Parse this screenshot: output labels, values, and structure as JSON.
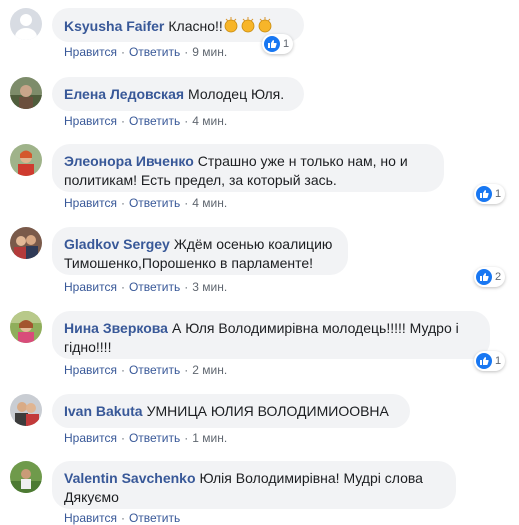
{
  "action_labels": {
    "like": "Нравится",
    "reply": "Ответить",
    "separator": "·"
  },
  "comments": [
    {
      "author": "Ksyusha Faifer",
      "text": "Класно!!",
      "emoji": [
        "clapping-hands",
        "clapping-hands",
        "clapping-hands"
      ],
      "time": "9 мин.",
      "likes": "1"
    },
    {
      "author": "Елена Ледовская",
      "text": "Молодец Юля.",
      "time": "4 мин."
    },
    {
      "author": "Элеонора Ивченко",
      "text": "Страшно уже н только нам, но и политикам! Есть предел, за который зась.",
      "time": "4 мин.",
      "likes": "1"
    },
    {
      "author": "Gladkov Sergey",
      "text": "Ждём осенью коалицию Тимошенко,Порошенко в парламенте!",
      "time": "3 мин.",
      "likes": "2"
    },
    {
      "author": "Нина Зверкова",
      "text": "А Юля Володимирівна молодець!!!!! Мудро і гідно!!!!",
      "time": "2 мин.",
      "likes": "1"
    },
    {
      "author": "Ivan Bakuta",
      "text": "УМНИЦА ЮЛИЯ ВОЛОДИМИООВНА",
      "time": "1 мин."
    },
    {
      "author": "Valentin Savchenko",
      "text": "Юлія Володимирівна! Мудрі слова Дякуємо",
      "time": ""
    }
  ],
  "colors": {
    "author": "#385898",
    "bubble": "#f2f3f5",
    "like_badge": "#1877f2",
    "meta_text": "#606770"
  }
}
